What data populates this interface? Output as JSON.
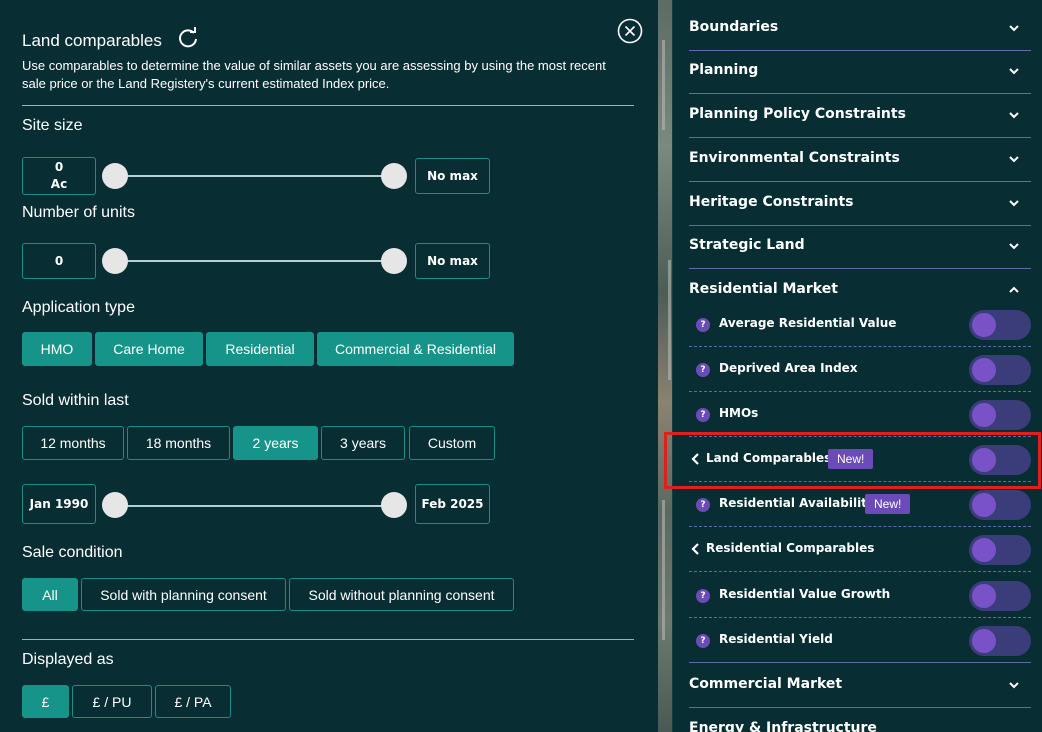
{
  "left_panel": {
    "title": "Land comparables",
    "description": "Use comparables to determine the value of similar assets you are assessing by using the most recent sale price or the Land Registery's current estimated Index price.",
    "site_size": {
      "title": "Site size",
      "min_value": "0",
      "min_unit": "Ac",
      "max_label": "No max"
    },
    "units": {
      "title": "Number of units",
      "min_value": "0",
      "max_label": "No max"
    },
    "application_type": {
      "title": "Application type",
      "options": [
        "HMO",
        "Care Home",
        "Residential",
        "Commercial & Residential"
      ]
    },
    "sold_within": {
      "title": "Sold within last",
      "options": [
        "12 months",
        "18 months",
        "2 years",
        "3 years",
        "Custom"
      ],
      "selected": "2 years",
      "date_from": "Jan  1990",
      "date_to": "Feb  2025"
    },
    "sale_condition": {
      "title": "Sale condition",
      "options": [
        "All",
        "Sold with planning consent",
        "Sold without planning consent"
      ],
      "selected": "All"
    },
    "displayed_as": {
      "title": "Displayed as",
      "options": [
        "£",
        "£ / PU",
        "£ / PA"
      ],
      "selected": "£"
    }
  },
  "right_panel": {
    "categories_top": [
      "Boundaries",
      "Planning",
      "Planning Policy Constraints",
      "Environmental Constraints",
      "Heritage Constraints",
      "Strategic Land"
    ],
    "residential_market": {
      "label": "Residential Market",
      "layers": [
        {
          "label": "Average Residential Value",
          "icon": "help-icon",
          "enabled": false
        },
        {
          "label": "Deprived Area Index",
          "icon": "help-icon",
          "enabled": false
        },
        {
          "label": "HMOs",
          "icon": "help-icon",
          "enabled": false
        },
        {
          "label": "Land Comparables",
          "icon": "chevron-left-icon",
          "badge": "New!",
          "enabled": false
        },
        {
          "label": "Residential Availability",
          "icon": "help-icon",
          "badge": "New!",
          "enabled": false
        },
        {
          "label": "Residential Comparables",
          "icon": "chevron-left-icon",
          "enabled": false
        },
        {
          "label": "Residential Value Growth",
          "icon": "help-icon",
          "enabled": false
        },
        {
          "label": "Residential Yield",
          "icon": "help-icon",
          "enabled": false
        }
      ]
    },
    "categories_bottom": [
      "Commercial Market",
      "Energy & Infrastructure"
    ],
    "help_glyph": "?"
  },
  "colors": {
    "panel_bg": "#082d33",
    "accent": "#16948a",
    "badge": "#6b4bb8",
    "highlight": "#e0201c"
  }
}
